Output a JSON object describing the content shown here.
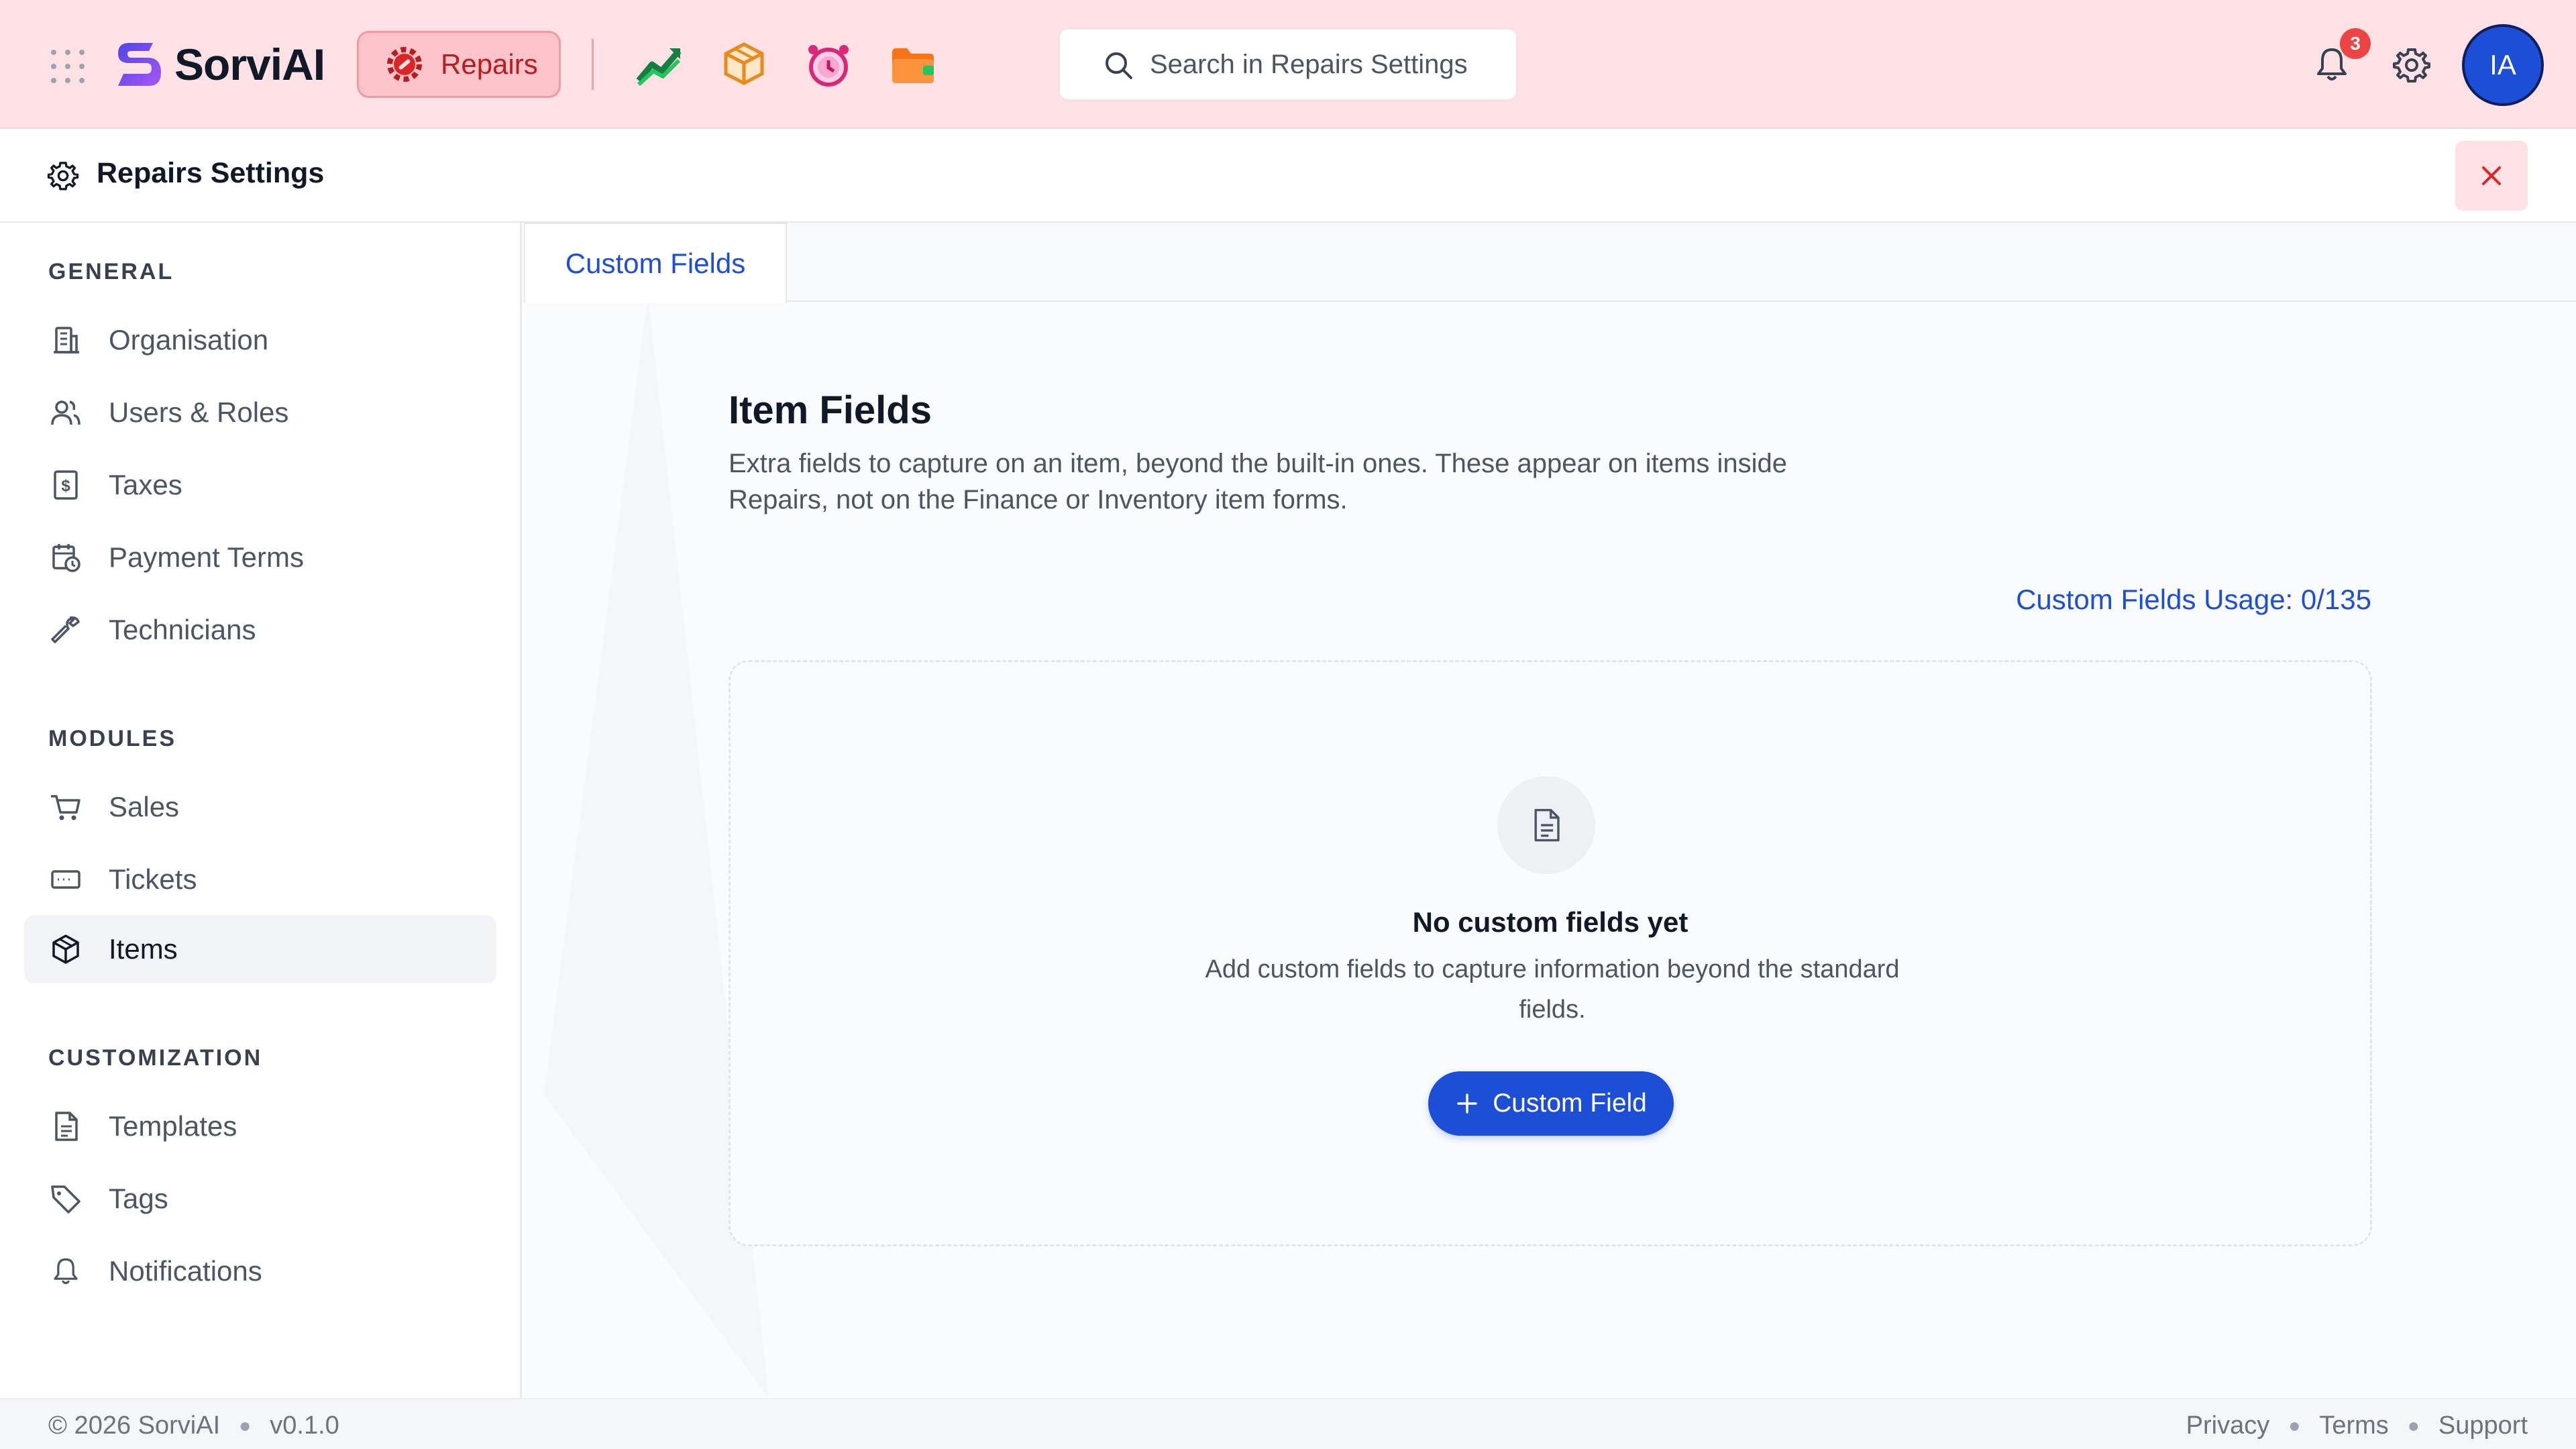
{
  "app": {
    "brand": "SorviAI",
    "current_app_label": "Repairs",
    "search_placeholder": "Search in Repairs Settings",
    "notification_count": "3",
    "avatar_initials": "IA",
    "icons": {
      "launcher": "grid-dots-icon",
      "current_app": "repair-gear-icon",
      "apps": [
        "finance-chart-icon",
        "inventory-box-icon",
        "alarm-clock-icon",
        "folder-icon"
      ],
      "notifications": "bell-icon",
      "settings": "gear-icon"
    },
    "colors": {
      "topbar_bg": "#fde1e4",
      "accent": "#1d4ed8",
      "danger": "#ef4444"
    }
  },
  "settings_header": {
    "title": "Repairs Settings",
    "close_icon": "close-icon"
  },
  "sidebar": {
    "sections": [
      {
        "label": "GENERAL",
        "items": [
          {
            "label": "Organisation",
            "icon": "building-icon"
          },
          {
            "label": "Users & Roles",
            "icon": "users-icon"
          },
          {
            "label": "Taxes",
            "icon": "dollar-doc-icon"
          },
          {
            "label": "Payment Terms",
            "icon": "calendar-clock-icon"
          },
          {
            "label": "Technicians",
            "icon": "wrench-icon"
          }
        ]
      },
      {
        "label": "MODULES",
        "items": [
          {
            "label": "Sales",
            "icon": "cart-icon"
          },
          {
            "label": "Tickets",
            "icon": "ticket-icon"
          },
          {
            "label": "Items",
            "icon": "box-icon",
            "active": true
          }
        ]
      },
      {
        "label": "CUSTOMIZATION",
        "items": [
          {
            "label": "Templates",
            "icon": "document-icon"
          },
          {
            "label": "Tags",
            "icon": "tag-icon"
          },
          {
            "label": "Notifications",
            "icon": "bell-icon"
          }
        ]
      }
    ]
  },
  "main": {
    "tabs": [
      {
        "label": "Custom Fields",
        "active": true
      }
    ],
    "section_title": "Item Fields",
    "section_desc": "Extra fields to capture on an item, beyond the built-in ones. These appear on items inside Repairs, not on the Finance or Inventory item forms.",
    "usage_label": "Custom Fields Usage: 0/135",
    "empty_state": {
      "icon": "document-icon",
      "title": "No custom fields yet",
      "desc": "Add custom fields to capture information beyond the standard fields.",
      "button_label": "Custom Field"
    }
  },
  "footer": {
    "copyright": "© 2026 SorviAI",
    "version": "v0.1.0",
    "links": [
      "Privacy",
      "Terms",
      "Support"
    ]
  }
}
